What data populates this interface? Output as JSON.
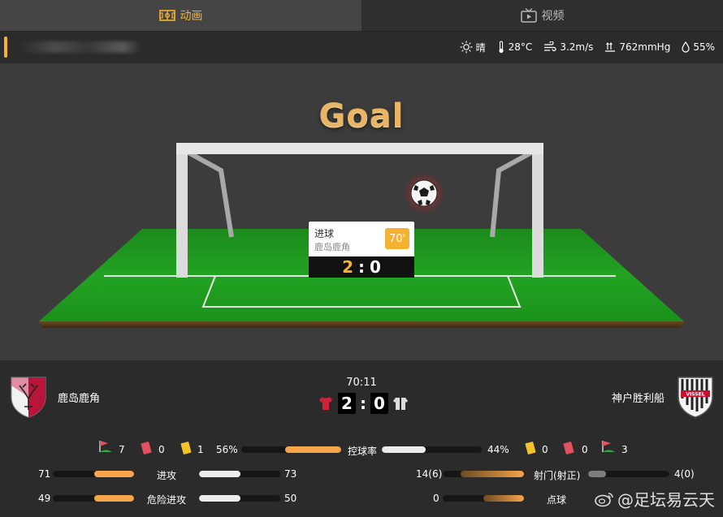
{
  "tabs": [
    {
      "label": "动画",
      "icon": "field-icon",
      "active": true
    },
    {
      "label": "视频",
      "icon": "tv-icon",
      "active": false
    }
  ],
  "weather": {
    "condition": "晴",
    "temperature": "28°C",
    "wind": "3.2m/s",
    "pressure": "762mmHg",
    "humidity": "55%"
  },
  "animation": {
    "headline": "Goal",
    "event_type": "进球",
    "event_team": "鹿岛鹿角",
    "event_minute": "70'",
    "score_home": "2",
    "score_away": "0",
    "colon": ":"
  },
  "match": {
    "home_team": "鹿岛鹿角",
    "away_team": "神户胜利船",
    "clock": "70:11",
    "home_score": "2",
    "away_score": "0",
    "colon": ":"
  },
  "possession": {
    "home_corners": "7",
    "home_red": "0",
    "home_yellow": "1",
    "home_pct": "56%",
    "label": "控球率",
    "away_pct": "44%",
    "away_yellow": "0",
    "away_red": "0",
    "away_corners": "3",
    "home_fraction": 0.56,
    "away_fraction": 0.44
  },
  "stats_left": [
    {
      "label": "进攻",
      "home": "71",
      "away": "73",
      "home_fraction": 0.49,
      "away_fraction": 0.51
    },
    {
      "label": "危险进攻",
      "home": "49",
      "away": "50",
      "home_fraction": 0.49,
      "away_fraction": 0.51
    }
  ],
  "stats_right": [
    {
      "label": "射门(射正)",
      "home": "14(6)",
      "away": "4(0)",
      "home_fraction": 0.78,
      "away_fraction": 0.22
    },
    {
      "label": "点球",
      "home": "0",
      "away": "",
      "home_fraction": 0.5,
      "away_fraction": 0.0
    }
  ],
  "watermark": "@足坛易云天",
  "colors": {
    "accent": "#f5b130",
    "bar_home": "#f6a54a",
    "bar_away": "#ececec",
    "pitch": "#1f9a1f",
    "home_kit": "#d0213a"
  }
}
